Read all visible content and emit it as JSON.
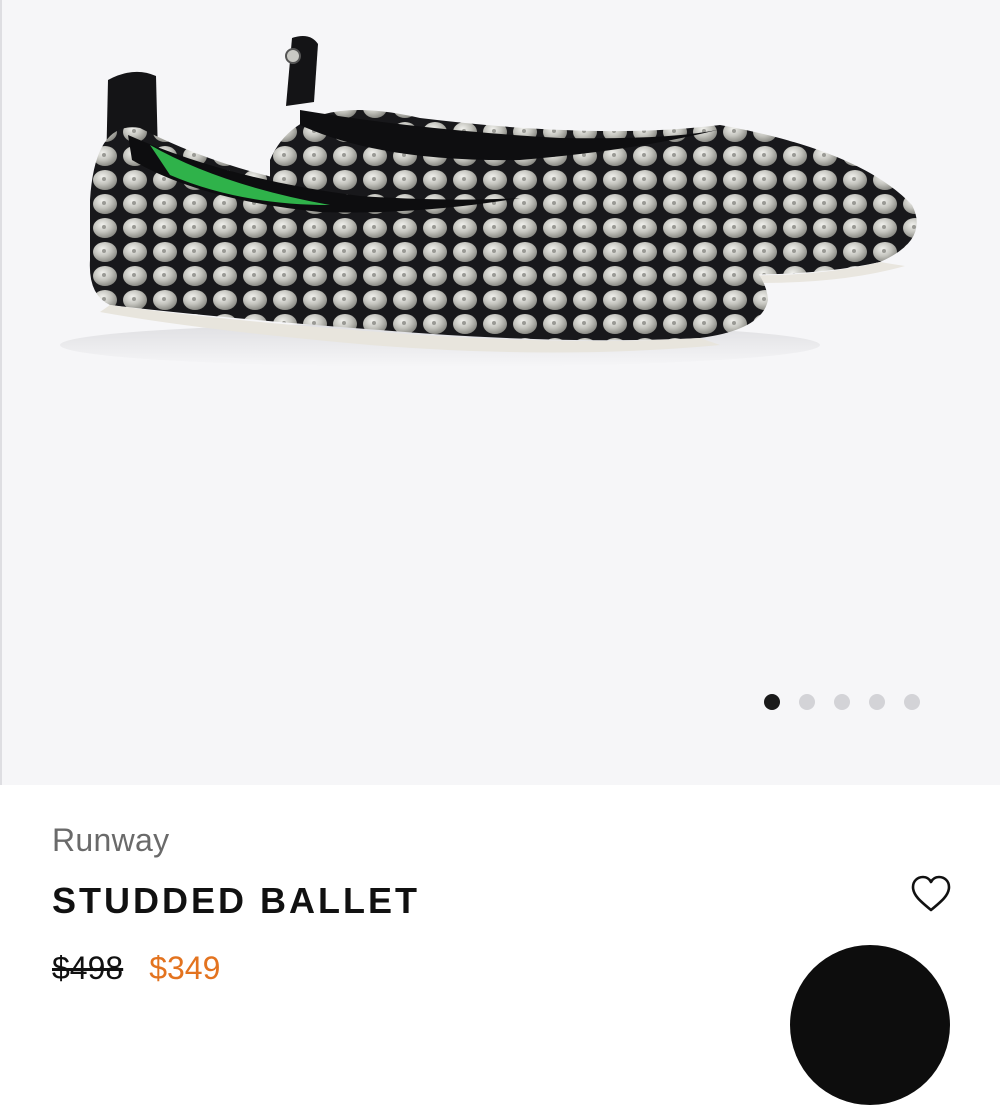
{
  "product": {
    "brand": "Runway",
    "title": "STUDDED BALLET",
    "price_original": "$498",
    "price_sale": "$349"
  },
  "gallery": {
    "image": "studded-ballet-flats-photo",
    "dots_count": 5,
    "active_index": 0
  },
  "icons": {
    "wishlist": "heart-outline-icon"
  },
  "colors": {
    "gallery_bg": "#f6f6f8",
    "sale_price": "#e3731f",
    "dot_active": "#1a1a1a",
    "dot_inactive": "#d3d3d7",
    "shoe_black": "#16161a",
    "stud_silver": "#c9c9c4",
    "lining_green": "#2fb24a"
  }
}
